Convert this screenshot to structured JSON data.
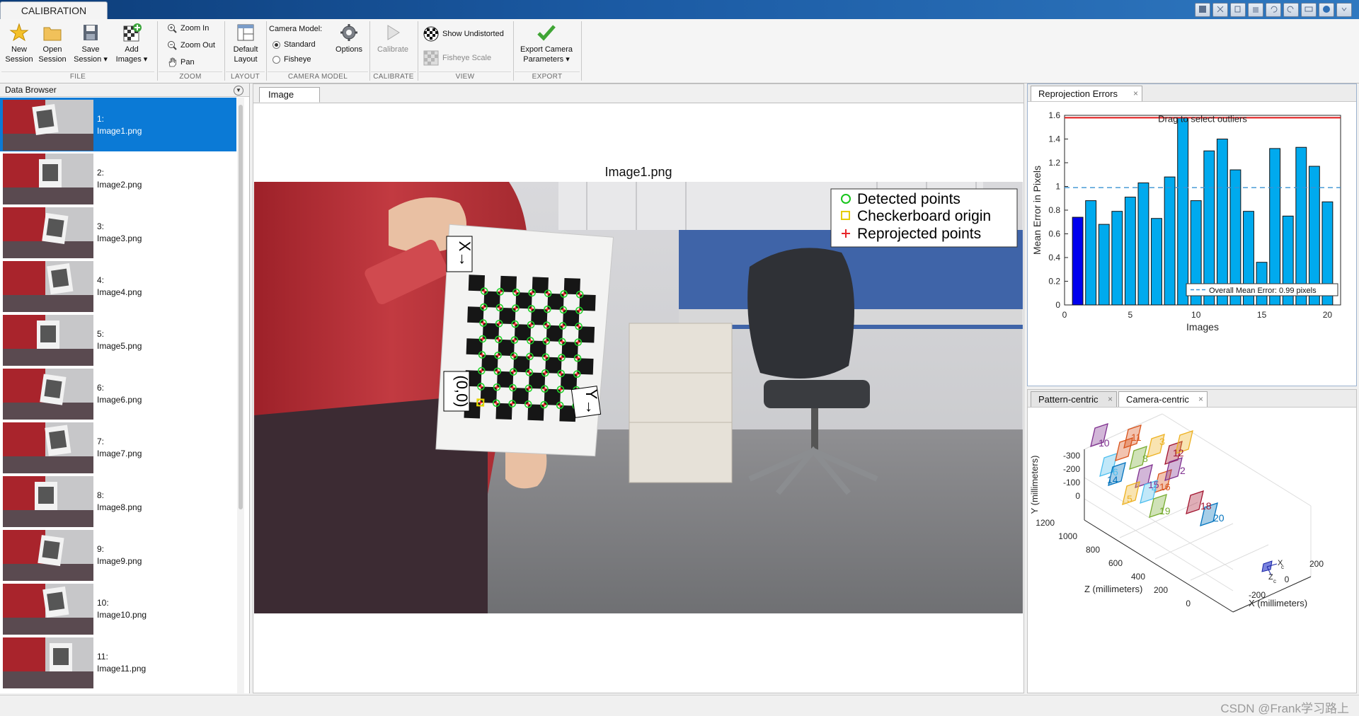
{
  "app": {
    "tab_label": "CALIBRATION",
    "watermark": "CSDN @Frank学习路上"
  },
  "toolstrip": {
    "file": {
      "label": "FILE",
      "new_session": [
        "New",
        "Session"
      ],
      "open_session": [
        "Open",
        "Session"
      ],
      "save_session": [
        "Save",
        "Session"
      ],
      "add_images": [
        "Add",
        "Images"
      ]
    },
    "zoom": {
      "label": "ZOOM",
      "zoom_in": "Zoom In",
      "zoom_out": "Zoom Out",
      "pan": "Pan"
    },
    "layout": {
      "label": "LAYOUT",
      "default_layout": [
        "Default",
        "Layout"
      ]
    },
    "camera_model": {
      "label": "CAMERA MODEL",
      "title": "Camera Model:",
      "standard": "Standard",
      "fisheye": "Fisheye",
      "selected": "Standard",
      "options": "Options"
    },
    "calibrate": {
      "label": "CALIBRATE",
      "calibrate": "Calibrate"
    },
    "view": {
      "label": "VIEW",
      "show_undistorted": "Show Undistorted",
      "fisheye_scale": "Fisheye Scale"
    },
    "export": {
      "label": "EXPORT",
      "export_params": [
        "Export Camera",
        "Parameters"
      ]
    }
  },
  "data_browser": {
    "title": "Data Browser",
    "items": [
      {
        "num": "1:",
        "name": "Image1.png",
        "selected": true
      },
      {
        "num": "2:",
        "name": "Image2.png"
      },
      {
        "num": "3:",
        "name": "Image3.png"
      },
      {
        "num": "4:",
        "name": "Image4.png"
      },
      {
        "num": "5:",
        "name": "Image5.png"
      },
      {
        "num": "6:",
        "name": "Image6.png"
      },
      {
        "num": "7:",
        "name": "Image7.png"
      },
      {
        "num": "8:",
        "name": "Image8.png"
      },
      {
        "num": "9:",
        "name": "Image9.png"
      },
      {
        "num": "10:",
        "name": "Image10.png"
      },
      {
        "num": "11:",
        "name": "Image11.png"
      }
    ]
  },
  "image_panel": {
    "tab": "Image",
    "title": "Image1.png",
    "legend": {
      "detected": "Detected points",
      "origin": "Checkerboard origin",
      "reprojected": "Reprojected points"
    },
    "labels": {
      "x_axis": "X→",
      "origin": "(0,0)",
      "y_axis": "Y→"
    }
  },
  "reprojection_panel": {
    "tab": "Reprojection Errors",
    "close": "×",
    "drag_hint": "Drag to select outliers",
    "overall_label": "Overall Mean Error: 0.99 pixels"
  },
  "extrinsics_panel": {
    "tab_pattern": "Pattern-centric",
    "tab_camera": "Camera-centric",
    "close": "×",
    "ylabel": "Y (millimeters)",
    "zlabel": "Z (millimeters)",
    "xlabel": "X (millimeters)",
    "y_ticks": [
      "-300",
      "-200",
      "-100",
      "0"
    ],
    "z_ticks": [
      "1200",
      "1000",
      "800",
      "600",
      "400",
      "200",
      "0"
    ],
    "x_ticks": [
      "-200",
      "0",
      "200"
    ],
    "camera_x": "X",
    "camera_z": "Z",
    "camera_sub": "c",
    "pattern_labels": [
      "10",
      "11",
      "3",
      "6",
      "8",
      "12",
      "14",
      "15",
      "16",
      "5",
      "4",
      "19",
      "18",
      "20",
      "2"
    ],
    "colors": [
      "#7e2f8e",
      "#d9531b",
      "#edb120",
      "#4dbeee",
      "#77ac30",
      "#a2142f",
      "#0072bd"
    ]
  },
  "chart_data": {
    "type": "bar",
    "xlabel": "Images",
    "ylabel": "Mean Error in Pixels",
    "ylim": [
      0,
      1.6
    ],
    "xlim": [
      0,
      21
    ],
    "x_ticks": [
      0,
      5,
      10,
      15,
      20
    ],
    "y_ticks": [
      0,
      0.2,
      0.4,
      0.6,
      0.8,
      1,
      1.2,
      1.4,
      1.6
    ],
    "categories": [
      1,
      2,
      3,
      4,
      5,
      6,
      7,
      8,
      9,
      10,
      11,
      12,
      13,
      14,
      15,
      16,
      17,
      18,
      19,
      20
    ],
    "values": [
      0.74,
      0.88,
      0.68,
      0.79,
      0.91,
      1.03,
      0.73,
      1.08,
      1.58,
      0.88,
      1.3,
      1.4,
      1.14,
      0.79,
      0.36,
      1.32,
      0.75,
      1.33,
      1.17,
      0.87
    ],
    "highlighted_index": 0,
    "overall_mean": 0.99,
    "bar_color": "#00aaee",
    "highlight_color": "#0000ee",
    "mean_line_color": "#3a93d2",
    "outlier_line": 1.58
  }
}
